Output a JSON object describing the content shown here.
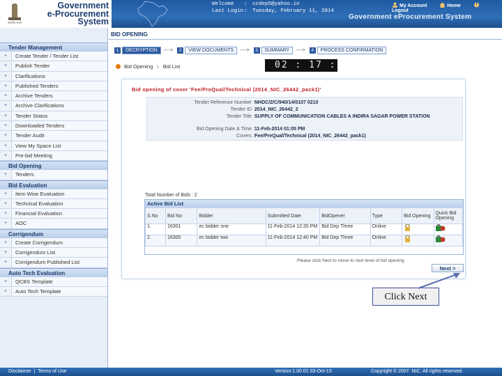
{
  "header": {
    "brand_line1": "Government",
    "brand_line2": "e-Procurement",
    "brand_line3": "System",
    "emblem_text": "सत्यमेव जयते",
    "welcome_label": "Welcome",
    "welcome_value": "ccdep5@yahoo.in",
    "lastlogin_label": "Last Login",
    "lastlogin_value": "Tuesday, February 11, 2014",
    "colon": ":",
    "my_account": "My Account",
    "home": "Home",
    "logout": "Logout",
    "system_name": "Government eProcurement System"
  },
  "sidebar": {
    "sections": [
      {
        "title": "Tender Management",
        "items": [
          "Create Tender / Tender List",
          "Publish Tender",
          "Clarifications",
          "Published Tenders",
          "Archive Tenders",
          "Archive Clarifications",
          "Tender Status",
          "Downloaded Tenders",
          "Tender Audit",
          "View My Space List",
          "Pre-bid Meeting"
        ]
      },
      {
        "title": "Bid Opening",
        "items": [
          "Tenders"
        ]
      },
      {
        "title": "Bid Evaluation",
        "items": [
          "Item Wise Evaluation",
          "Technical Evaluation",
          "Financial Evaluation",
          "AOC"
        ]
      },
      {
        "title": "Corrigendum",
        "items": [
          "Create Corrigendum",
          "Corrigendum List",
          "Corrigendum Published List"
        ]
      },
      {
        "title": "Auto Tech Evaluation",
        "items": [
          "QCBS Template",
          "Auto Tech Template"
        ]
      }
    ]
  },
  "main": {
    "page_title": "BID OPENING",
    "steps": [
      {
        "num": "1",
        "label": "DECRYPTION"
      },
      {
        "num": "2",
        "label": "VIEW DOCUMENTS"
      },
      {
        "num": "3",
        "label": "SUMMARY"
      },
      {
        "num": "4",
        "label": "PROCESS CONFIRMATION"
      }
    ],
    "step_sep": "---->",
    "breadcrumb_1": "Bid Opening",
    "breadcrumb_sep": "›",
    "breadcrumb_2": "Bid List",
    "timer": "02 : 17 :",
    "card_title": "Bid opening of cover 'Fee/PreQual/Technical (2014_NIC_26442_pack1)'",
    "details": [
      {
        "key": "Tender Reference Number",
        "value": "NHDC/2/C/940/14/0107 0210"
      },
      {
        "key": "Tender ID",
        "value": "2014_NIC_26442_2"
      },
      {
        "key": "Tender Title",
        "value": "SUPPLY OF COMMUNICATION CABLES A INDIRA SAGAR POWER STATION"
      },
      {
        "key": "Bid Opening Date & Time",
        "value": "11-Feb-2014 01:05 PM"
      },
      {
        "key": "Covers",
        "value": "Fee/PreQual/Technical (2014_NIC_26442_pack1)"
      }
    ],
    "total_text": "Total Number of Bids : 2",
    "table_caption": "Active Bid List",
    "columns": [
      "S.No",
      "Bid No",
      "Bidder",
      "Submitted Date",
      "BidOpener",
      "Type",
      "Bid Opening",
      "Quick Bid Opening"
    ],
    "rows": [
      {
        "sno": "1.",
        "bid_no": "16301",
        "bidder": "ec bidder one",
        "date": "11-Feb-2014 12:35 PM",
        "opener": "Bid Dep Three",
        "type": "Online"
      },
      {
        "sno": "2.",
        "bid_no": "16300",
        "bidder": "ec bidder two",
        "date": "11-Feb-2014 12:40 PM",
        "opener": "Bid Dep Three",
        "type": "Online"
      }
    ],
    "help_text": "Please click Next to move to next level of bid opening",
    "next_button": "Next >",
    "callout": "Click Next"
  },
  "footer": {
    "disclaimer": "Disclaimer",
    "sep": "|",
    "terms": "Terms of Use",
    "version": "Version:1.00.01 03-Oct-13",
    "copyright": "Copyright © 2007. NIC. All rights reserved."
  },
  "colors": {
    "header_blue": "#1f5aa0",
    "brand_text": "#1d3f73",
    "title_red": "#c0202a",
    "active_step": "#2c5aa0"
  }
}
